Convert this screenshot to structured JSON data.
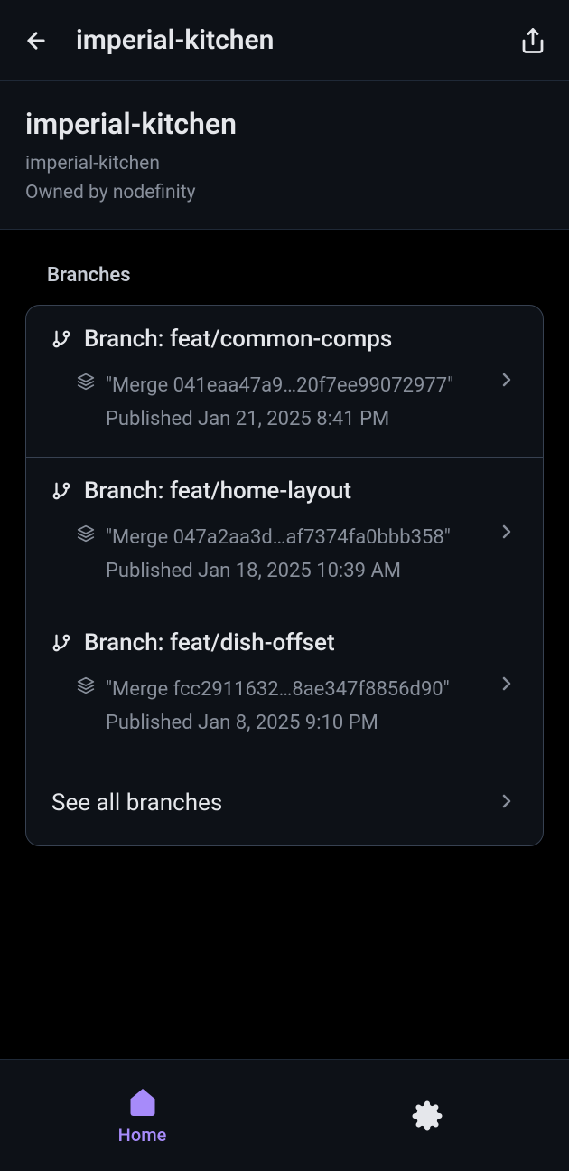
{
  "header": {
    "title": "imperial-kitchen"
  },
  "repo": {
    "title": "imperial-kitchen",
    "subtitle": "imperial-kitchen",
    "owned_by": "Owned by nodefinity"
  },
  "section": {
    "branches_label": "Branches"
  },
  "branches": [
    {
      "name": "Branch: feat/common-comps",
      "merge": "\"Merge 041eaa47a9…20f7ee99072977\"",
      "published": "Published Jan 21, 2025 8:41 PM"
    },
    {
      "name": "Branch: feat/home-layout",
      "merge": "\"Merge 047a2aa3d…af7374fa0bbb358\"",
      "published": "Published Jan 18, 2025 10:39 AM"
    },
    {
      "name": "Branch: feat/dish-offset",
      "merge": "\"Merge fcc2911632…8ae347f8856d90\"",
      "published": "Published Jan 8, 2025 9:10 PM"
    }
  ],
  "see_all": "See all branches",
  "nav": {
    "home": "Home"
  }
}
